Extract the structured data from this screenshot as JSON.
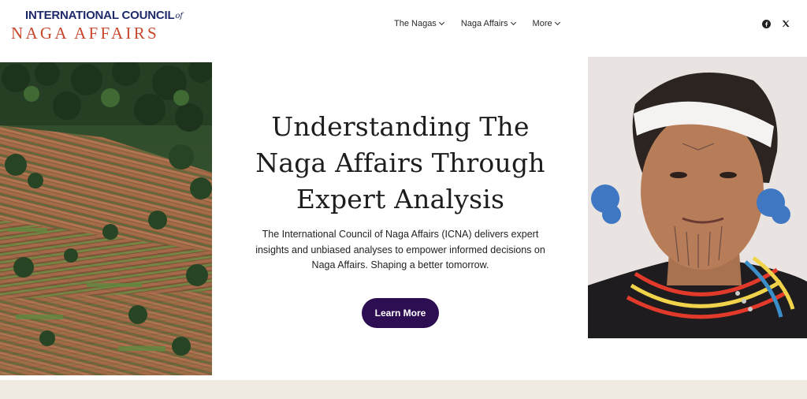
{
  "logo": {
    "line1": "INTERNATIONAL COUNCIL",
    "of": "of",
    "line2": "NAGA AFFAIRS"
  },
  "nav": {
    "items": [
      {
        "label": "The Nagas"
      },
      {
        "label": "Naga Affairs"
      },
      {
        "label": "More"
      }
    ]
  },
  "social": {
    "icons": [
      "facebook-icon",
      "x-icon"
    ]
  },
  "hero": {
    "title_lines": [
      "Understanding The",
      "Naga Affairs Through",
      "Expert Analysis"
    ],
    "desc_lines": [
      "The International Council of Naga Affairs (ICNA) delivers expert",
      "insights and unbiased analyses to empower informed decisions on",
      "Naga Affairs. Shaping a better tomorrow."
    ],
    "button_label": "Learn More"
  },
  "colors": {
    "brand_navy": "#1f2a6b",
    "brand_red": "#c8462b",
    "button": "#2e0e52",
    "band": "#efebe3"
  }
}
